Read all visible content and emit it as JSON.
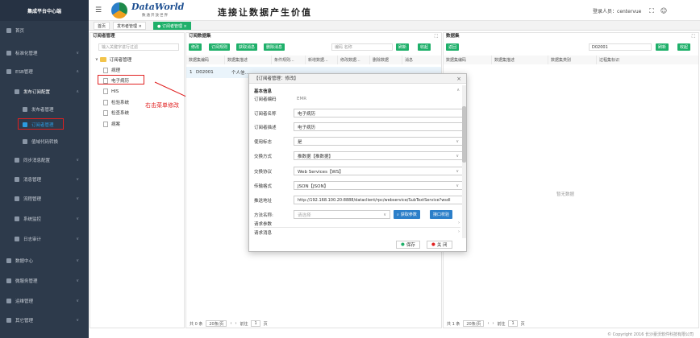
{
  "app": {
    "title": "集成平台中心端",
    "logo": "DataWorld",
    "logo_sub": "数通开放世界",
    "slogan": "连接让数据产生价值"
  },
  "user": {
    "label": "登录人员：",
    "name": "centervue"
  },
  "sidebar": {
    "items": [
      {
        "label": "首页"
      },
      {
        "label": "标准化管理"
      },
      {
        "label": "ESB管理"
      },
      {
        "label": "发布订阅配置"
      },
      {
        "label": "发布者管理"
      },
      {
        "label": "订阅者管理"
      },
      {
        "label": "值域代码转换"
      },
      {
        "label": "同步消息配置"
      },
      {
        "label": "消息管理"
      },
      {
        "label": "流程管理"
      },
      {
        "label": "系统监控"
      },
      {
        "label": "日志审计"
      },
      {
        "label": "数据中心"
      },
      {
        "label": "微服务管理"
      },
      {
        "label": "运维管理"
      },
      {
        "label": "其它管理"
      }
    ]
  },
  "tabs": [
    {
      "label": "首页"
    },
    {
      "label": "发布者管理 ×"
    },
    {
      "label": "● 订阅者管理 ×"
    }
  ],
  "left_panel": {
    "title": "订阅者管理",
    "search_placeholder": "输入关键字进行过滤",
    "tree_root": "订阅者管理",
    "tree_items": [
      "病理",
      "电子病历",
      "HIS",
      "检验系统",
      "检查系统",
      "病案"
    ]
  },
  "mid_panel": {
    "title": "订阅数据集",
    "buttons": [
      "修改",
      "订阅规则",
      "获取消息",
      "删除消息"
    ],
    "search_placeholder": "编码 名称",
    "refresh": "刷新",
    "collapse": "收起",
    "columns": [
      "数据集编码",
      "数据集描述",
      "条件规则...",
      "新增数据...",
      "修改数据...",
      "删除数据",
      "消息"
    ],
    "row": {
      "idx": "1",
      "code": "D02001",
      "desc": "个人信..."
    },
    "pager": {
      "total": "共 0 条",
      "size": "20条/页",
      "goto": "前往",
      "page": "1",
      "unit": "页"
    }
  },
  "right_panel": {
    "title": "数据集",
    "button": "返回",
    "search_value": "D02001",
    "refresh": "刷新",
    "collapse": "收起",
    "columns": [
      "数据集编码",
      "数据集描述",
      "数据集类别",
      "过程集标识"
    ],
    "empty": "暂无数据",
    "pager": {
      "total": "共 1 条",
      "size": "20条/页",
      "goto": "前往",
      "page": "1",
      "unit": "页"
    }
  },
  "modal": {
    "title": "【订阅者管理：修改】",
    "section": "基本信息",
    "fields": [
      {
        "label": "订阅者编码",
        "value": "EMR"
      },
      {
        "label": "订阅者名称",
        "value": "电子病历"
      },
      {
        "label": "订阅者描述",
        "value": "电子病历"
      },
      {
        "label": "使用标志",
        "value": "是"
      },
      {
        "label": "交换方式",
        "value": "推数据【推数据】"
      },
      {
        "label": "交换协议",
        "value": "Web Services【WS】"
      },
      {
        "label": "传输格式",
        "value": "JSON【JSON】"
      },
      {
        "label": "推送地址",
        "value": "http://192.168.100.20:8888/dataclient/rpc/webservice/SubTextService?wsdl"
      }
    ],
    "method_label": "方法名称:",
    "method_placeholder": "请选择",
    "get_params": "获取参数",
    "test_interface": "接口校验",
    "collapsibles": [
      "请求参数",
      "请求消息"
    ],
    "save": "保存",
    "close": "关 闭"
  },
  "annotation": {
    "text": "右击菜单修改"
  },
  "footer": "© Copyright 2016 长沙豪沃软件科技有限公司",
  "colors": {
    "sidebar": "#2d3a4b",
    "accent": "#1fb06a",
    "highlight": "#e02020"
  }
}
